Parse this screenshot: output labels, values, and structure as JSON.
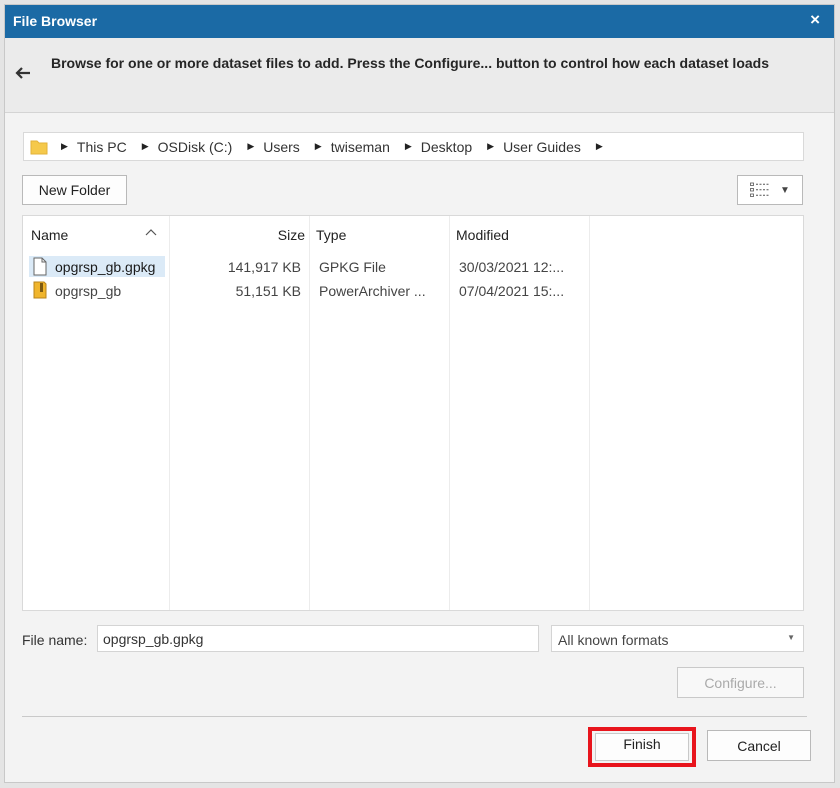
{
  "window": {
    "title": "File Browser",
    "close_glyph": "×"
  },
  "header": {
    "back_icon": "arrow-left-icon",
    "instruction": "Browse for one or more dataset files to add. Press the Configure... button to control how each dataset loads"
  },
  "breadcrumb": {
    "folder_icon": "folder-icon",
    "items": [
      {
        "label": "This PC"
      },
      {
        "label": "OSDisk (C:)"
      },
      {
        "label": "Users"
      },
      {
        "label": "twiseman"
      },
      {
        "label": "Desktop"
      },
      {
        "label": "User Guides"
      }
    ]
  },
  "toolbar": {
    "new_folder_label": "New Folder",
    "view_icon": "details-view-icon"
  },
  "file_list": {
    "columns": {
      "name": "Name",
      "size": "Size",
      "type": "Type",
      "modified": "Modified"
    },
    "rows": [
      {
        "name": "opgrsp_gb.gpkg",
        "size": "141,917 KB",
        "type": "GPKG File",
        "modified": "30/03/2021 12:...",
        "icon": "file-icon",
        "selected": true
      },
      {
        "name": "opgrsp_gb",
        "size": "51,151 KB",
        "type": "PowerArchiver ...",
        "modified": "07/04/2021 15:...",
        "icon": "archive-icon",
        "selected": false
      }
    ]
  },
  "footer": {
    "file_name_label": "File name:",
    "file_name_value": "opgrsp_gb.gpkg",
    "format_value": "All known formats",
    "configure_label": "Configure...",
    "finish_label": "Finish",
    "cancel_label": "Cancel"
  },
  "colors": {
    "titlebar": "#1b6aa5",
    "selection": "#dbeaf7",
    "highlight": "#e8141c"
  }
}
